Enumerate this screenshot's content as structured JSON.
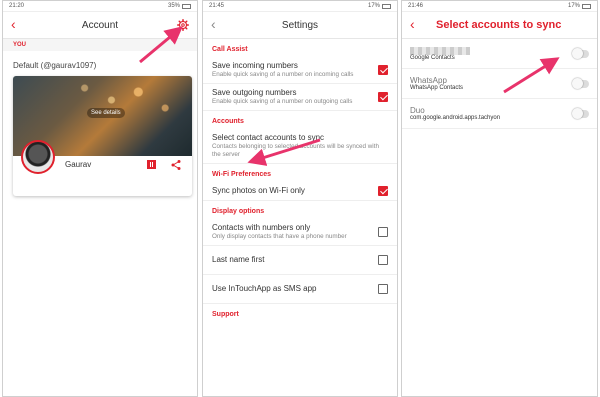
{
  "screen1": {
    "status_time": "21:20",
    "status_battery": "35%",
    "title": "Account",
    "section_label": "YOU",
    "default_text": "Default (@gaurav1097)",
    "see_details": "See details",
    "profile_name": "Gaurav"
  },
  "screen2": {
    "status_time": "21:45",
    "status_battery": "17%",
    "title": "Settings",
    "sections": {
      "call_assist": "Call Assist",
      "accounts": "Accounts",
      "wifi": "Wi-Fi Preferences",
      "display": "Display options",
      "support": "Support"
    },
    "rows": {
      "save_incoming": {
        "title": "Save incoming numbers",
        "desc": "Enable quick saving of a number on incoming calls",
        "checked": true
      },
      "save_outgoing": {
        "title": "Save outgoing numbers",
        "desc": "Enable quick saving of a number on outgoing calls",
        "checked": true
      },
      "select_accounts": {
        "title": "Select contact accounts to sync",
        "desc": "Contacts belonging to selected accounts will be synced with the server"
      },
      "sync_photos": {
        "title": "Sync photos on Wi-Fi only",
        "checked": true
      },
      "contacts_numbers": {
        "title": "Contacts with numbers only",
        "desc": "Only display contacts that have a phone number",
        "checked": false
      },
      "last_name_first": {
        "title": "Last name first",
        "checked": false
      },
      "sms_app": {
        "title": "Use InTouchApp as SMS app",
        "checked": false
      }
    }
  },
  "screen3": {
    "status_time": "21:46",
    "status_battery": "17%",
    "title": "Select accounts to sync",
    "accounts": [
      {
        "name": "",
        "type": "Google Contacts",
        "enabled": false
      },
      {
        "name": "WhatsApp",
        "type": "WhatsApp Contacts",
        "enabled": false
      },
      {
        "name": "Duo",
        "type": "com.google.android.apps.tachyon",
        "enabled": false
      }
    ]
  },
  "colors": {
    "accent": "#e0212d",
    "arrow": "#e8336b"
  },
  "icons": [
    "back-arrow-icon",
    "gear-icon",
    "qr-code-icon",
    "share-icon",
    "checkbox-icon",
    "toggle-icon"
  ]
}
